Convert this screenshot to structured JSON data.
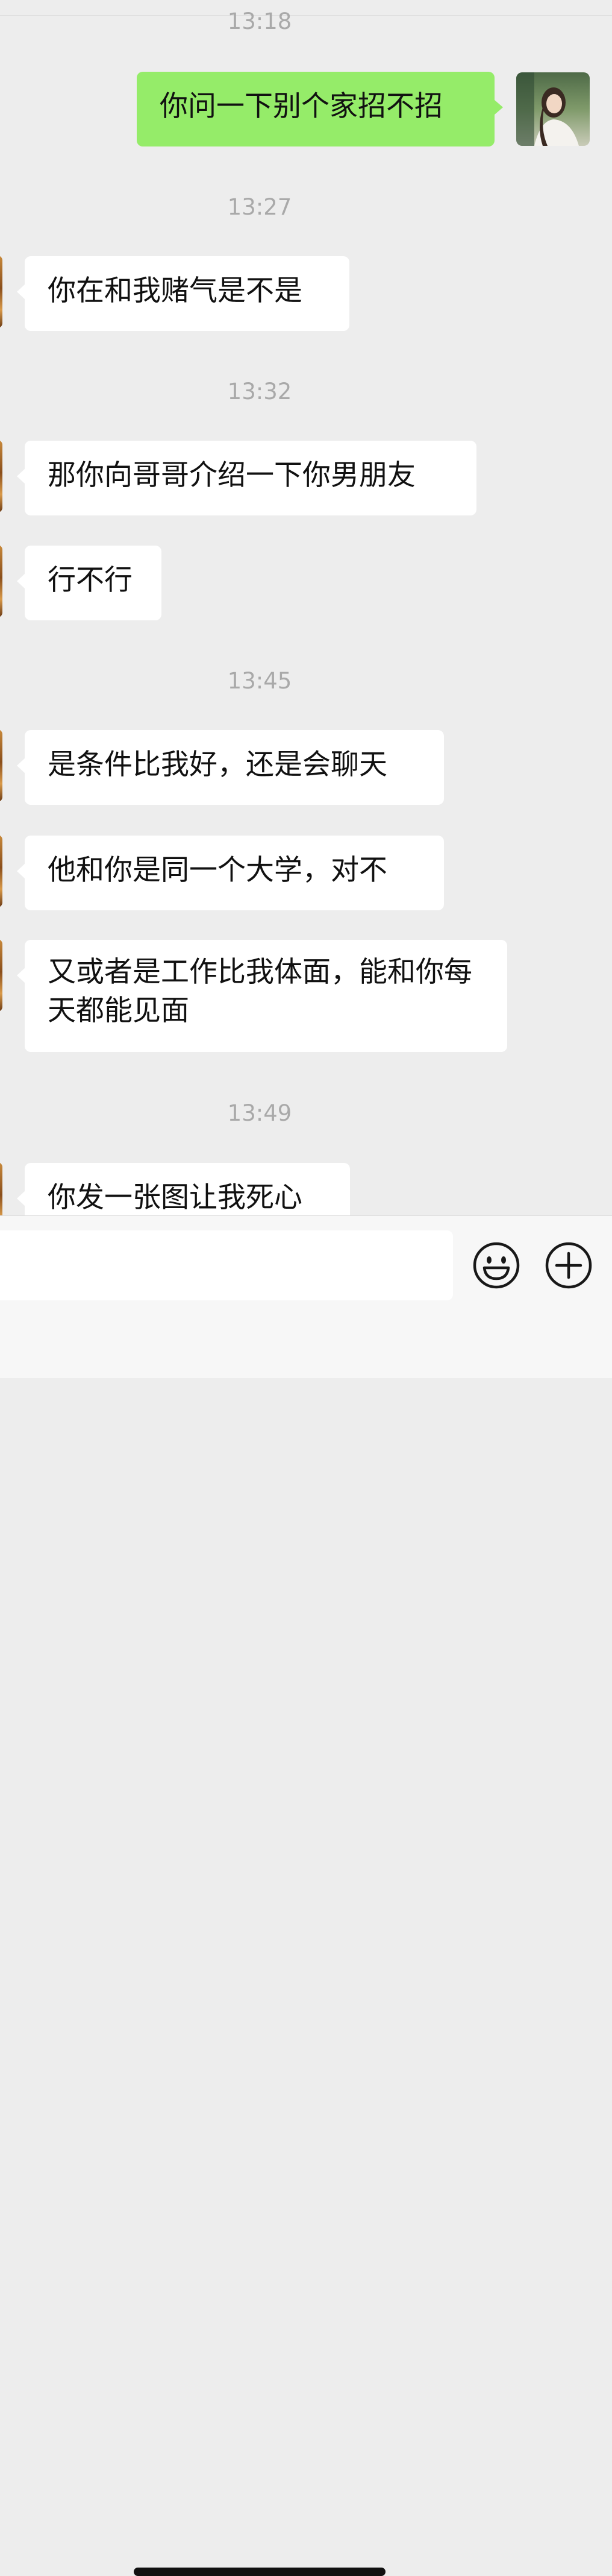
{
  "messages": [
    {
      "type": "time",
      "text": "13:18"
    },
    {
      "type": "out",
      "text": "你问一下别个家招不招"
    },
    {
      "type": "time",
      "text": "13:27"
    },
    {
      "type": "in",
      "text": "你在和我赌气是不是"
    },
    {
      "type": "time",
      "text": "13:32"
    },
    {
      "type": "in",
      "text": "那你向哥哥介绍一下你男朋友"
    },
    {
      "type": "in",
      "text": "行不行"
    },
    {
      "type": "time",
      "text": "13:45"
    },
    {
      "type": "in",
      "text": "是条件比我好，还是会聊天"
    },
    {
      "type": "in",
      "text": "他和你是同一个大学，对不"
    },
    {
      "type": "in",
      "text": "又或者是工作比我体面，能和你每天都能见面"
    },
    {
      "type": "time",
      "text": "13:49"
    },
    {
      "type": "in",
      "text": "你发一张图让我死心"
    }
  ],
  "input": {
    "value": "",
    "emoji_icon": "smiley-face-icon",
    "more_icon": "plus-circle-icon"
  },
  "colors": {
    "background": "#ededed",
    "outgoing_bubble": "#95ec69",
    "incoming_bubble": "#ffffff",
    "timestamp_text": "#a9a9a9"
  }
}
